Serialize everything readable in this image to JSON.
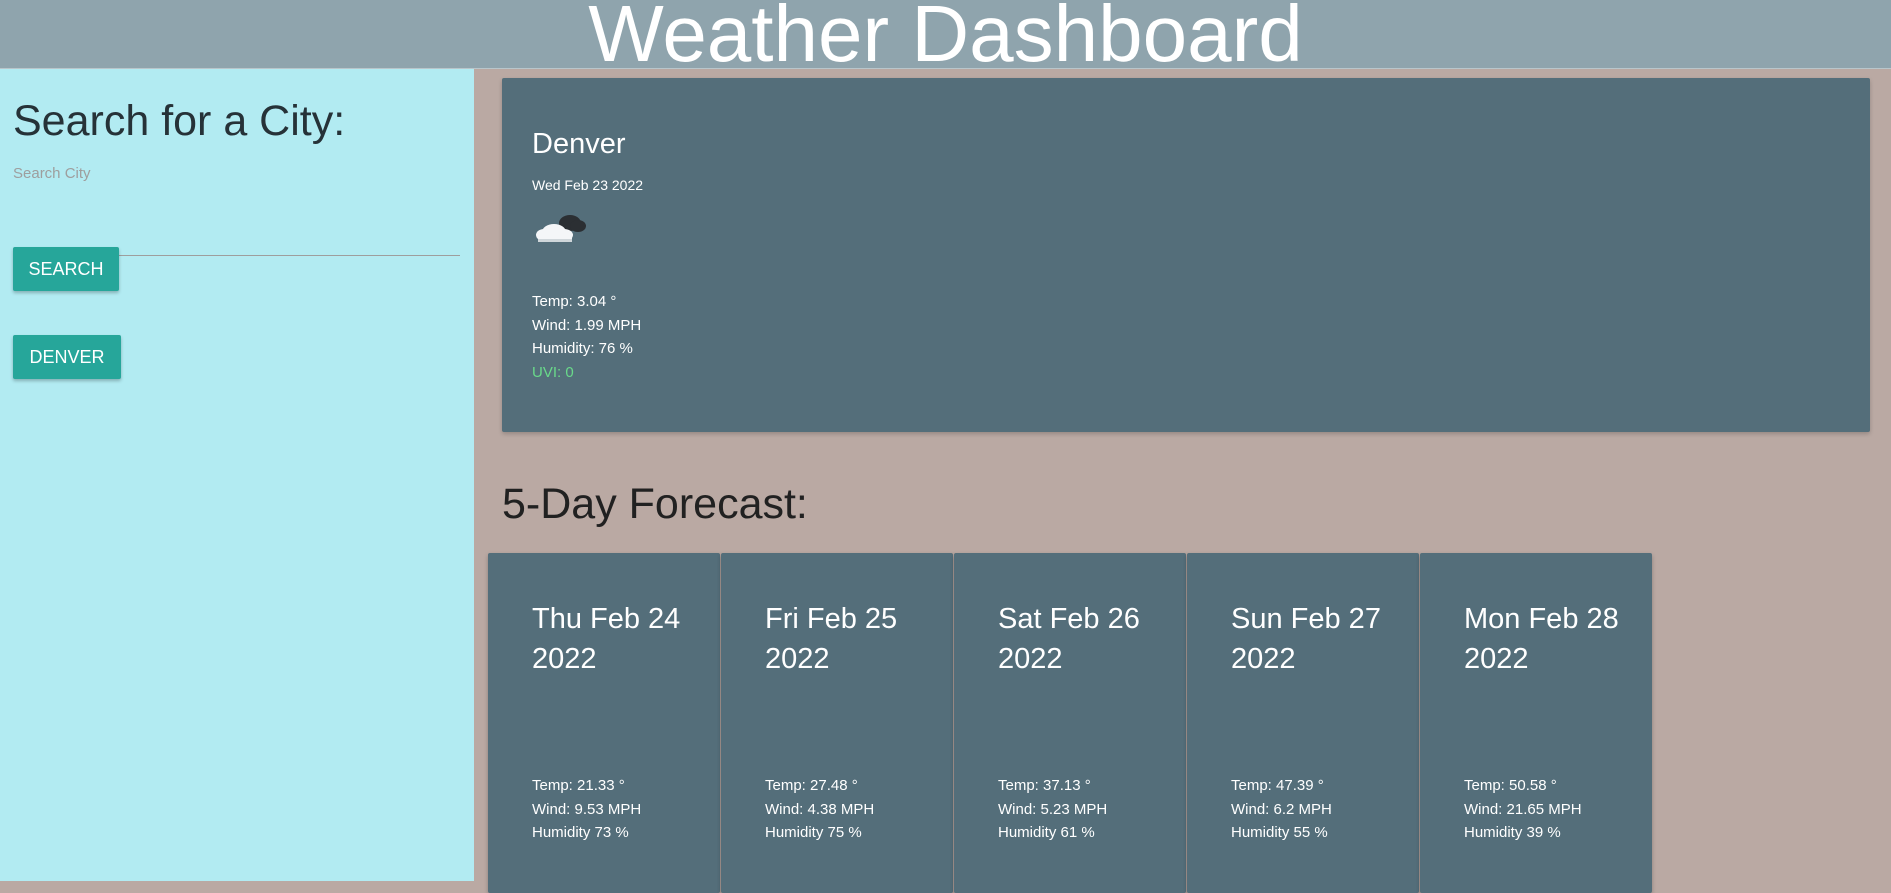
{
  "header": {
    "title": "Weather Dashboard"
  },
  "sidebar": {
    "heading": "Search for a City:",
    "search_label": "Search City",
    "search_value": "",
    "search_button": "Search",
    "history": [
      "Denver"
    ]
  },
  "current": {
    "city": "Denver",
    "date": "Wed Feb 23 2022",
    "icon": "cloudy-night-icon",
    "temp": "Temp: 3.04 °",
    "wind": "Wind: 1.99 MPH",
    "humidity": "Humidity: 76 %",
    "uvi": "UVI: 0",
    "uvi_color": "#69d98a"
  },
  "forecast": {
    "title": "5-Day Forecast:",
    "days": [
      {
        "date": "Thu Feb 24 2022",
        "temp": "Temp: 21.33 °",
        "wind": "Wind: 9.53 MPH",
        "humidity": "Humidity 73 %"
      },
      {
        "date": "Fri Feb 25 2022",
        "temp": "Temp: 27.48 °",
        "wind": "Wind: 4.38 MPH",
        "humidity": "Humidity 75 %"
      },
      {
        "date": "Sat Feb 26 2022",
        "temp": "Temp: 37.13 °",
        "wind": "Wind: 5.23 MPH",
        "humidity": "Humidity 61 %"
      },
      {
        "date": "Sun Feb 27 2022",
        "temp": "Temp: 47.39 °",
        "wind": "Wind: 6.2 MPH",
        "humidity": "Humidity 55 %"
      },
      {
        "date": "Mon Feb 28 2022",
        "temp": "Temp: 50.58 °",
        "wind": "Wind: 21.65 MPH",
        "humidity": "Humidity 39 %"
      }
    ]
  },
  "colors": {
    "header_bg": "#8fa4ad",
    "sidebar_bg": "#b2ebf2",
    "main_bg": "#baa9a3",
    "card_bg": "#546e7a",
    "button_bg": "#26a69a"
  }
}
